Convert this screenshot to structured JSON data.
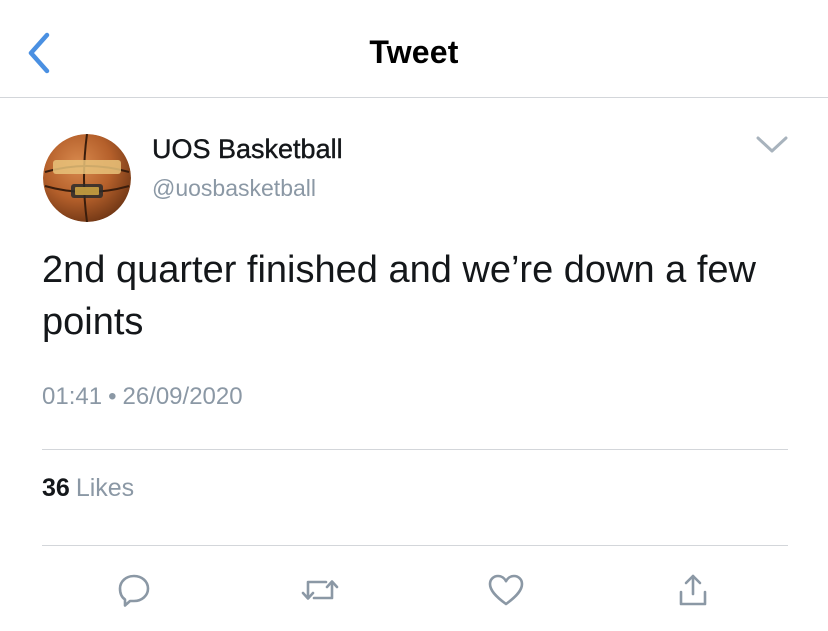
{
  "nav": {
    "title": "Tweet",
    "back_icon": "chevron-left-icon",
    "accent_color": "#4a90e2"
  },
  "tweet": {
    "author": {
      "display_name": "UOS Basketball",
      "handle": "@uosbasketball",
      "avatar_icon": "basketball-avatar"
    },
    "text": "2nd quarter finished and we’re down a few points",
    "time": "01:41",
    "separator": "•",
    "date": "26/09/2020",
    "likes": {
      "count": "36",
      "label": "Likes"
    }
  },
  "actions": [
    {
      "name": "reply",
      "icon": "reply-icon"
    },
    {
      "name": "retweet",
      "icon": "retweet-icon"
    },
    {
      "name": "like",
      "icon": "heart-icon"
    },
    {
      "name": "share",
      "icon": "share-icon"
    }
  ],
  "colors": {
    "text": "#14171a",
    "secondary": "#8b98a5",
    "divider": "#d3d6da"
  }
}
